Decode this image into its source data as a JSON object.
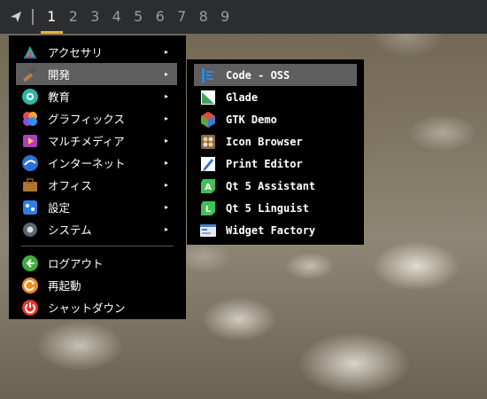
{
  "topbar": {
    "workspaces": [
      "1",
      "2",
      "3",
      "4",
      "5",
      "6",
      "7",
      "8",
      "9"
    ],
    "active_workspace": "1",
    "accent_color": "#e8b04a"
  },
  "main_menu": {
    "items": [
      {
        "label": "アクセサリ",
        "icon": "accessories-icon",
        "has_submenu": true
      },
      {
        "label": "開発",
        "icon": "development-icon",
        "has_submenu": true,
        "selected": true
      },
      {
        "label": "教育",
        "icon": "education-icon",
        "has_submenu": true
      },
      {
        "label": "グラフィックス",
        "icon": "graphics-icon",
        "has_submenu": true
      },
      {
        "label": "マルチメディア",
        "icon": "multimedia-icon",
        "has_submenu": true
      },
      {
        "label": "インターネット",
        "icon": "internet-icon",
        "has_submenu": true
      },
      {
        "label": "オフィス",
        "icon": "office-icon",
        "has_submenu": true
      },
      {
        "label": "設定",
        "icon": "settings-icon",
        "has_submenu": true
      },
      {
        "label": "システム",
        "icon": "system-icon",
        "has_submenu": true
      }
    ],
    "actions": [
      {
        "label": "ログアウト",
        "icon": "logout-icon"
      },
      {
        "label": "再起動",
        "icon": "reboot-icon"
      },
      {
        "label": "シャットダウン",
        "icon": "shutdown-icon"
      }
    ],
    "arrow_glyph": "▸"
  },
  "sub_menu": {
    "items": [
      {
        "label": "Code - OSS",
        "icon": "code-oss-icon",
        "selected": true
      },
      {
        "label": "Glade",
        "icon": "glade-icon"
      },
      {
        "label": "GTK Demo",
        "icon": "gtk-demo-icon"
      },
      {
        "label": "Icon Browser",
        "icon": "icon-browser-icon"
      },
      {
        "label": "Print Editor",
        "icon": "print-editor-icon"
      },
      {
        "label": "Qt 5 Assistant",
        "icon": "qt-assistant-icon"
      },
      {
        "label": "Qt 5 Linguist",
        "icon": "qt-linguist-icon"
      },
      {
        "label": "Widget Factory",
        "icon": "widget-factory-icon"
      }
    ]
  }
}
